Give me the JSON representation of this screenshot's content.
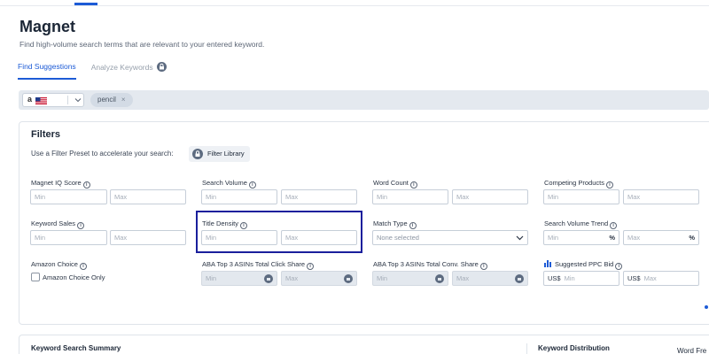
{
  "header": {
    "title": "Magnet",
    "subtitle": "Find high-volume search terms that are relevant to your entered keyword."
  },
  "tabs": [
    {
      "label": "Find Suggestions",
      "active": true
    },
    {
      "label": "Analyze Keywords",
      "active": false,
      "icon": "lock-icon"
    }
  ],
  "search": {
    "marketplace_logo": "a",
    "marketplace_flag": "us-flag-icon",
    "keyword_chip": "pencil",
    "chip_remove": "×"
  },
  "filters": {
    "title": "Filters",
    "preset_text": "Use a Filter Preset to accelerate your search:",
    "library_button": "Filter Library",
    "fields": {
      "magnet_iq": {
        "label": "Magnet IQ Score",
        "min": "Min",
        "max": "Max"
      },
      "search_volume": {
        "label": "Search Volume",
        "min": "Min",
        "max": "Max"
      },
      "word_count": {
        "label": "Word Count",
        "min": "Min",
        "max": "Max"
      },
      "competing_products": {
        "label": "Competing Products",
        "min": "Min",
        "max": "Max"
      },
      "keyword_sales": {
        "label": "Keyword Sales",
        "min": "Min",
        "max": "Max"
      },
      "title_density": {
        "label": "Title Density",
        "min": "Min",
        "max": "Max"
      },
      "match_type": {
        "label": "Match Type",
        "placeholder": "None selected"
      },
      "search_volume_trend": {
        "label": "Search Volume Trend",
        "min": "Min",
        "max": "Max",
        "unit": "%"
      },
      "amazon_choice": {
        "label": "Amazon Choice",
        "checkbox_label": "Amazon Choice Only"
      },
      "aba_click_share": {
        "label": "ABA Top 3 ASINs Total Click Share",
        "min": "Min",
        "max": "Max"
      },
      "aba_conv_share": {
        "label": "ABA Top 3 ASINs Total Conv. Share",
        "min": "Min",
        "max": "Max"
      },
      "ppc_bid": {
        "label": "Suggested PPC Bid",
        "currency": "US$",
        "min": "Min",
        "max": "Max"
      }
    }
  },
  "bottom": {
    "summary_title": "Keyword Search Summary",
    "distribution_title": "Keyword Distribution",
    "word_freq_title": "Word Fre"
  },
  "colors": {
    "accent": "#1d5bd6",
    "highlight_border": "#1a1f9c",
    "search_bar_bg": "#e4e9ef",
    "disabled_input": "#e3e8ee"
  }
}
